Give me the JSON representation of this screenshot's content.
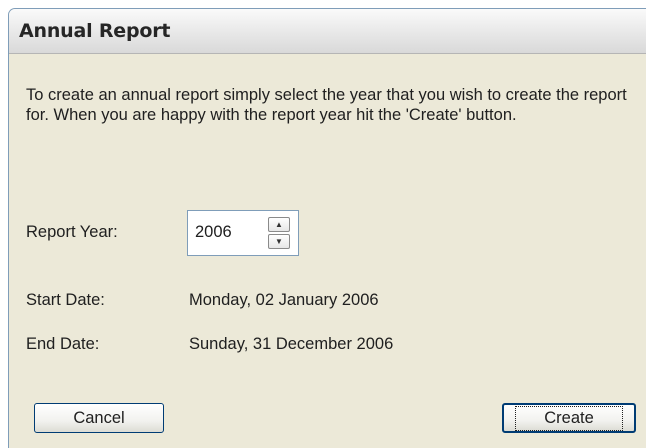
{
  "window": {
    "title": "Annual Report"
  },
  "description": "To create an annual report simply select the year that you wish to create the report for. When you are happy with the report year hit the 'Create' button.",
  "report_year": {
    "label": "Report Year:",
    "value": "2006"
  },
  "start_date": {
    "label": "Start Date:",
    "value": "Monday, 02 January 2006"
  },
  "end_date": {
    "label": "End Date:",
    "value": "Sunday, 31 December 2006"
  },
  "buttons": {
    "cancel_label": "Cancel",
    "create_label": "Create"
  },
  "icons": {
    "spin_up": "spin-up-arrow-icon",
    "spin_down": "spin-down-arrow-icon"
  }
}
